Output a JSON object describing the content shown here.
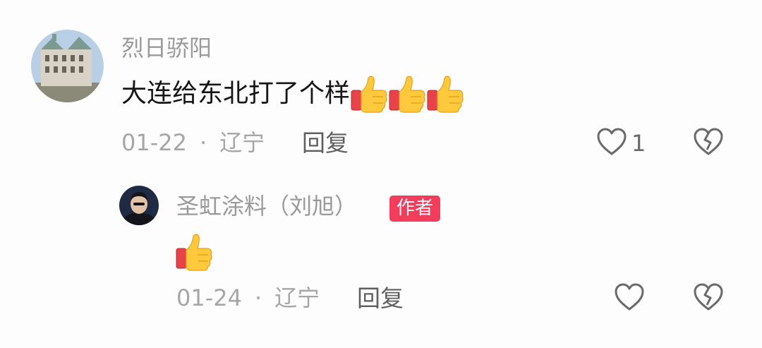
{
  "comment": {
    "username": "烈日骄阳",
    "text": "大连给东北打了个样",
    "emoji": [
      "thumbs-up-icon",
      "thumbs-up-icon",
      "thumbs-up-icon"
    ],
    "date": "01-22",
    "separator": "·",
    "location": "辽宁",
    "reply_label": "回复",
    "like_count": "1"
  },
  "reply": {
    "username": "圣虹涂料（刘旭）",
    "badge": "作者",
    "emoji": [
      "thumbs-up-icon"
    ],
    "date": "01-24",
    "separator": "·",
    "location": "辽宁",
    "reply_label": "回复"
  },
  "colors": {
    "badge": "#f23d5c",
    "meta_text": "#a6a6a6",
    "name_text": "#9a9a9a"
  }
}
